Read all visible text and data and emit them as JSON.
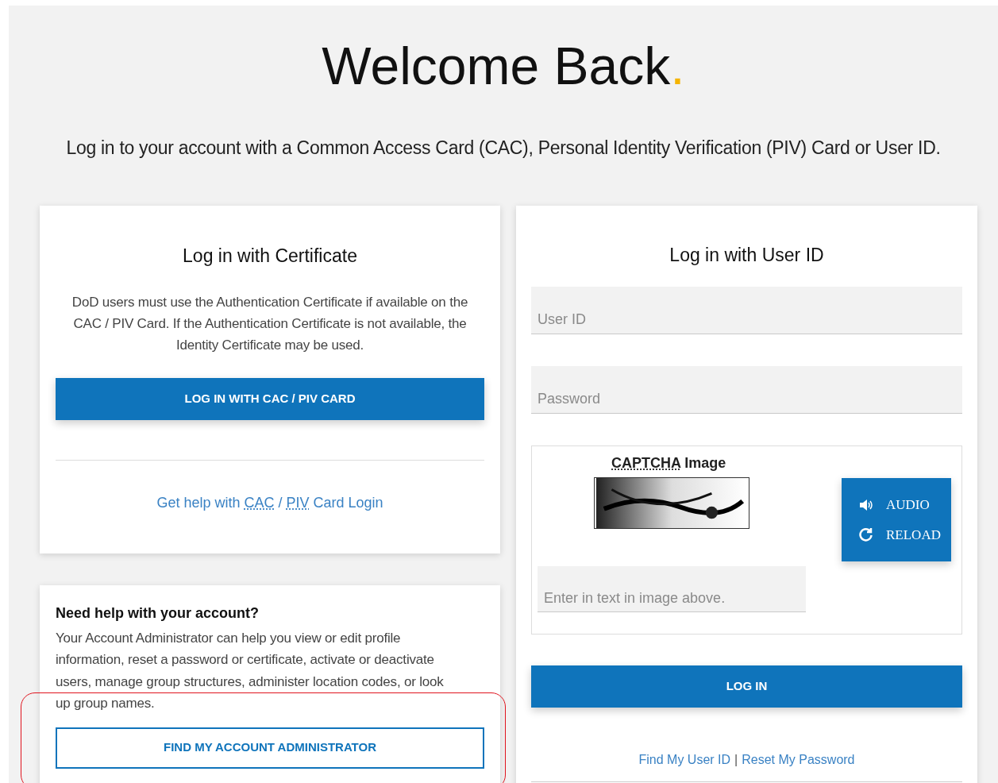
{
  "header": {
    "title": "Welcome Back",
    "title_mark": ".",
    "subtitle": "Log in to your account with a Common Access Card (CAC), Personal Identity Verification (PIV) Card or User ID."
  },
  "certificate_card": {
    "title": "Log in with Certificate",
    "description": "DoD users must use the Authentication Certificate if available on the CAC / PIV Card. If the Authentication Certificate is not available, the Identity Certificate may be used.",
    "button": "LOG IN WITH CAC / PIV CARD",
    "help_link": [
      {
        "text": "Get help with ",
        "abbr": false
      },
      {
        "text": "CAC",
        "abbr": true
      },
      {
        "text": " / ",
        "abbr": false
      },
      {
        "text": "PIV",
        "abbr": true
      },
      {
        "text": " Card Login",
        "abbr": false
      }
    ]
  },
  "help_card": {
    "title": "Need help with your account?",
    "text": "Your Account Administrator can help you view or edit profile information, reset a password or certificate, activate or deactivate users, manage group structures, administer location codes, or look up group names.",
    "button": "FIND MY ACCOUNT ADMINISTRATOR",
    "highlighted": true
  },
  "userid_card": {
    "title": "Log in with User ID",
    "fields": [
      {
        "placeholder": "User ID"
      },
      {
        "placeholder": "Password"
      }
    ],
    "captcha": {
      "label": [
        {
          "text": "CAPTCHA",
          "abbr": true
        },
        {
          "text": " Image",
          "abbr": false
        }
      ],
      "buttons": [
        {
          "kind": "audio",
          "label": "AUDIO"
        },
        {
          "kind": "reload",
          "label": "RELOAD"
        }
      ],
      "field": {
        "placeholder": "Enter in text in image above."
      }
    },
    "button": "LOG IN",
    "links": [
      {
        "kind": "link",
        "text": "Find My User ID"
      },
      {
        "kind": "separator",
        "text": "|"
      },
      {
        "kind": "link",
        "text": "Reset My Password"
      }
    ]
  }
}
